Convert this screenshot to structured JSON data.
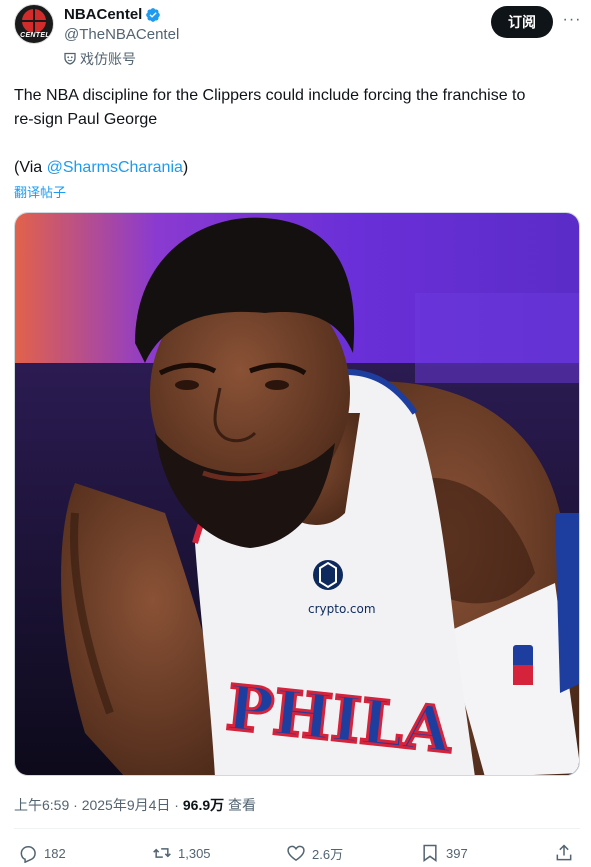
{
  "author": {
    "display_name": "NBACentel",
    "handle": "@TheNBACentel",
    "label": "戏仿账号",
    "avatar_text": "CENTEL",
    "verified_icon": "verified-badge-icon"
  },
  "header": {
    "subscribe_label": "订阅",
    "more_label": "···"
  },
  "tweet": {
    "line1": "The NBA discipline for the Clippers could include forcing the franchise to",
    "line2": "re-sign Paul George",
    "via_prefix": "(Via ",
    "via_mention": "@SharmsCharania",
    "via_suffix": ")",
    "translate_label": "翻译帖子"
  },
  "media": {
    "jersey_sponsor": "crypto.com",
    "jersey_text": "PHILA"
  },
  "meta": {
    "time": "上午6:59",
    "separator": " · ",
    "date": "2025年9月4日",
    "views_count": "96.9万",
    "views_label": " 查看"
  },
  "actions": {
    "replies": "182",
    "retweets": "1,305",
    "likes": "2.6万",
    "bookmarks": "397"
  },
  "colors": {
    "accent": "#1d9bf0",
    "text": "#0f1419",
    "muted": "#536471",
    "sixers_red": "#d4233a",
    "sixers_blue": "#1d3e9e"
  }
}
